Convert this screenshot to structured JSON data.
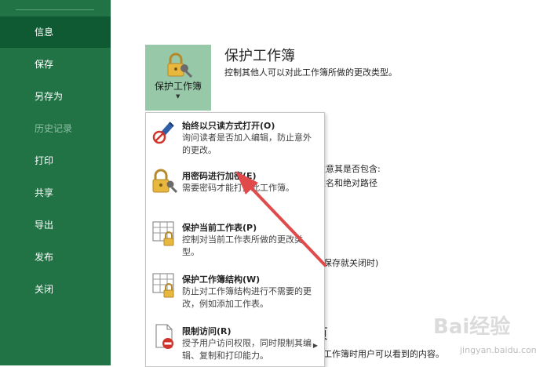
{
  "sidebar": {
    "items": [
      {
        "label": "信息",
        "active": true,
        "disabled": false
      },
      {
        "label": "保存",
        "active": false,
        "disabled": false
      },
      {
        "label": "另存为",
        "active": false,
        "disabled": false
      },
      {
        "label": "历史记录",
        "active": false,
        "disabled": true
      },
      {
        "label": "打印",
        "active": false,
        "disabled": false
      },
      {
        "label": "共享",
        "active": false,
        "disabled": false
      },
      {
        "label": "导出",
        "active": false,
        "disabled": false
      },
      {
        "label": "发布",
        "active": false,
        "disabled": false
      },
      {
        "label": "关闭",
        "active": false,
        "disabled": false
      }
    ]
  },
  "protect": {
    "button_label": "保护工作簿",
    "title": "保护工作簿",
    "description": "控制其他人可以对此工作簿所做的更改类型。"
  },
  "background": {
    "line1": "注意其是否包含:",
    "line2": "姓名和绝对路径",
    "line3": "保存就关闭时)",
    "heading_fragment": "页",
    "line4": "工作簿时用户可以看到的内容。"
  },
  "menu": {
    "items": [
      {
        "title": "始终以只读方式打开(O)",
        "desc": "询问读者是否加入编辑，防止意外的更改。",
        "icon": "pen-no-edit-icon"
      },
      {
        "title": "用密码进行加密(E)",
        "desc": "需要密码才能打开此工作簿。",
        "icon": "lock-key-icon"
      },
      {
        "title": "保护当前工作表(P)",
        "desc": "控制对当前工作表所做的更改类型。",
        "icon": "sheet-lock-icon"
      },
      {
        "title": "保护工作簿结构(W)",
        "desc": "防止对工作簿结构进行不需要的更改，例如添加工作表。",
        "icon": "workbook-structure-lock-icon"
      },
      {
        "title": "限制访问(R)",
        "desc": "授予用户访问权限，同时限制其编辑、复制和打印能力。",
        "icon": "restrict-access-icon"
      }
    ]
  },
  "watermark": {
    "text": "Bai经验",
    "sub": "jingyan.baidu.com"
  },
  "colors": {
    "sidebar": "#217346",
    "sidebar_active": "#0f5a33",
    "button_bg": "#97c8a8",
    "annotation": "#e04a4a"
  }
}
